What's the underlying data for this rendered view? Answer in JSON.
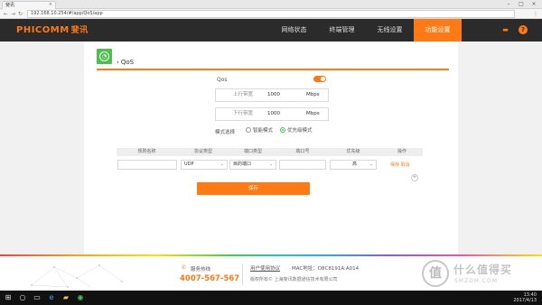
{
  "browser": {
    "tab_title": "斐讯",
    "url": "192.168.10.254/#/app/QoS/app"
  },
  "header": {
    "logo": "PHICOMM",
    "logo_cn": "斐讯",
    "nav": [
      {
        "label": "网络状态",
        "active": false
      },
      {
        "label": "终端管理",
        "active": false
      },
      {
        "label": "无线设置",
        "active": false
      },
      {
        "label": "功能设置",
        "active": true
      }
    ]
  },
  "qos": {
    "back_label": "QoS",
    "toggle_label": "Qos",
    "toggle_on": true,
    "upload_label": "上行带宽",
    "upload_value": "1000",
    "upload_unit": "Mbps",
    "download_label": "下行带宽",
    "download_value": "1000",
    "download_unit": "Mbps",
    "mode_label": "模式选择",
    "mode_options": [
      {
        "label": "智能模式",
        "selected": false
      },
      {
        "label": "优先级模式",
        "selected": true
      }
    ]
  },
  "table": {
    "headers": [
      "规则名称",
      "协议类型",
      "端口类型",
      "端口号",
      "优先级",
      "操作"
    ],
    "row": {
      "name": "",
      "protocol": "UDP",
      "port_type": "目的端口",
      "port": "",
      "priority": "高"
    },
    "ops": "保存 取消"
  },
  "save_button": "保存",
  "footer": {
    "hotline_label": "服务热线",
    "hotline_number": "4007-567-567",
    "license_link": "用户使用协议",
    "mac_label": "MAC地址：",
    "mac_value": "D8C8191A:A014",
    "copyright": "版权所有© 上海斐讯数据通信技术有限公司"
  },
  "watermark": {
    "logo": "值",
    "text": "什么值得买",
    "sub": "SMZDM.COM"
  },
  "taskbar": {
    "time": "13:40",
    "date": "2017/4/13"
  },
  "colors": {
    "accent": "#ff7a14",
    "header_bg": "#2b2b2b",
    "green": "#4cbf4c"
  }
}
